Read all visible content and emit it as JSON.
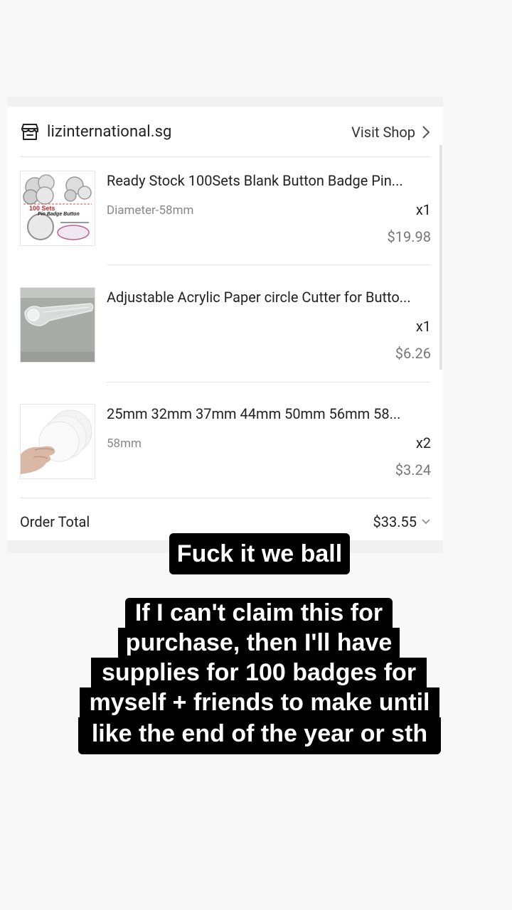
{
  "shop": {
    "name": "lizinternational.sg",
    "visit_label": "Visit Shop"
  },
  "items": [
    {
      "title": "Ready Stock 100Sets Blank Button Badge Pin...",
      "variant": "Diameter-58mm",
      "qty": "x1",
      "price": "$19.98",
      "thumb_text_1": "100 Sets",
      "thumb_text_2": "Pin Badge Button"
    },
    {
      "title": "Adjustable Acrylic Paper circle Cutter for Butto...",
      "variant": "",
      "qty": "x1",
      "price": "$6.26"
    },
    {
      "title": "25mm 32mm 37mm 44mm 50mm 56mm 58...",
      "variant": "58mm",
      "qty": "x2",
      "price": "$3.24"
    }
  ],
  "order_total": {
    "label": "Order Total",
    "value": "$33.55"
  },
  "captions": {
    "line1": "Fuck it we ball",
    "line2": [
      "If I can't claim this for",
      "purchase, then I'll have",
      "supplies for 100 badges for",
      "myself + friends to make until",
      "like the end of the year or sth"
    ]
  },
  "icons": {
    "shop": "shop-icon",
    "visit": "chevron-right-icon",
    "total": "chevron-down-icon"
  }
}
